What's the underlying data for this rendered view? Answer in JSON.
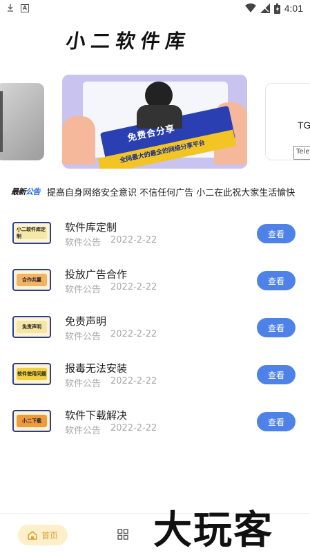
{
  "status_bar": {
    "time": "4:01"
  },
  "app": {
    "title": "小二软件库"
  },
  "banners": {
    "main_headline": "免费合分享",
    "main_subline": "全网最大的最全的网络分享平台",
    "right_text": "TG",
    "right_box_text": "Tele"
  },
  "notice": {
    "badge_prefix": "最新",
    "badge_suffix": "公告",
    "text": "提高自身网络安全意识  不信任何广告  小二在此祝大家生活愉快"
  },
  "list": {
    "view_label": "查看",
    "items": [
      {
        "title": "软件库定制",
        "category": "软件公告",
        "date": "2022-2-22",
        "thumb_text": "小二软件库定制",
        "thumb_color": "#f6e9a8"
      },
      {
        "title": "投放广告合作",
        "category": "软件公告",
        "date": "2022-2-22",
        "thumb_text": "合作共赢",
        "thumb_color": "#f4b264"
      },
      {
        "title": "免责声明",
        "category": "软件公告",
        "date": "2022-2-22",
        "thumb_text": "免责声明",
        "thumb_color": "#f5e6a6"
      },
      {
        "title": "报毒无法安装",
        "category": "软件公告",
        "date": "2022-2-22",
        "thumb_text": "软件使用问题",
        "thumb_color": "#f3d03e"
      },
      {
        "title": "软件下载解决",
        "category": "软件公告",
        "date": "2022-2-22",
        "thumb_text": "小二下载",
        "thumb_color": "#ef9b3c"
      }
    ]
  },
  "bottom_nav": {
    "home_label": "首页"
  },
  "watermark": "大玩客",
  "colors": {
    "accent": "#4f82e8",
    "home_bg": "#fcefc9",
    "home_text": "#d9a036",
    "meta": "#a8a8a8"
  }
}
